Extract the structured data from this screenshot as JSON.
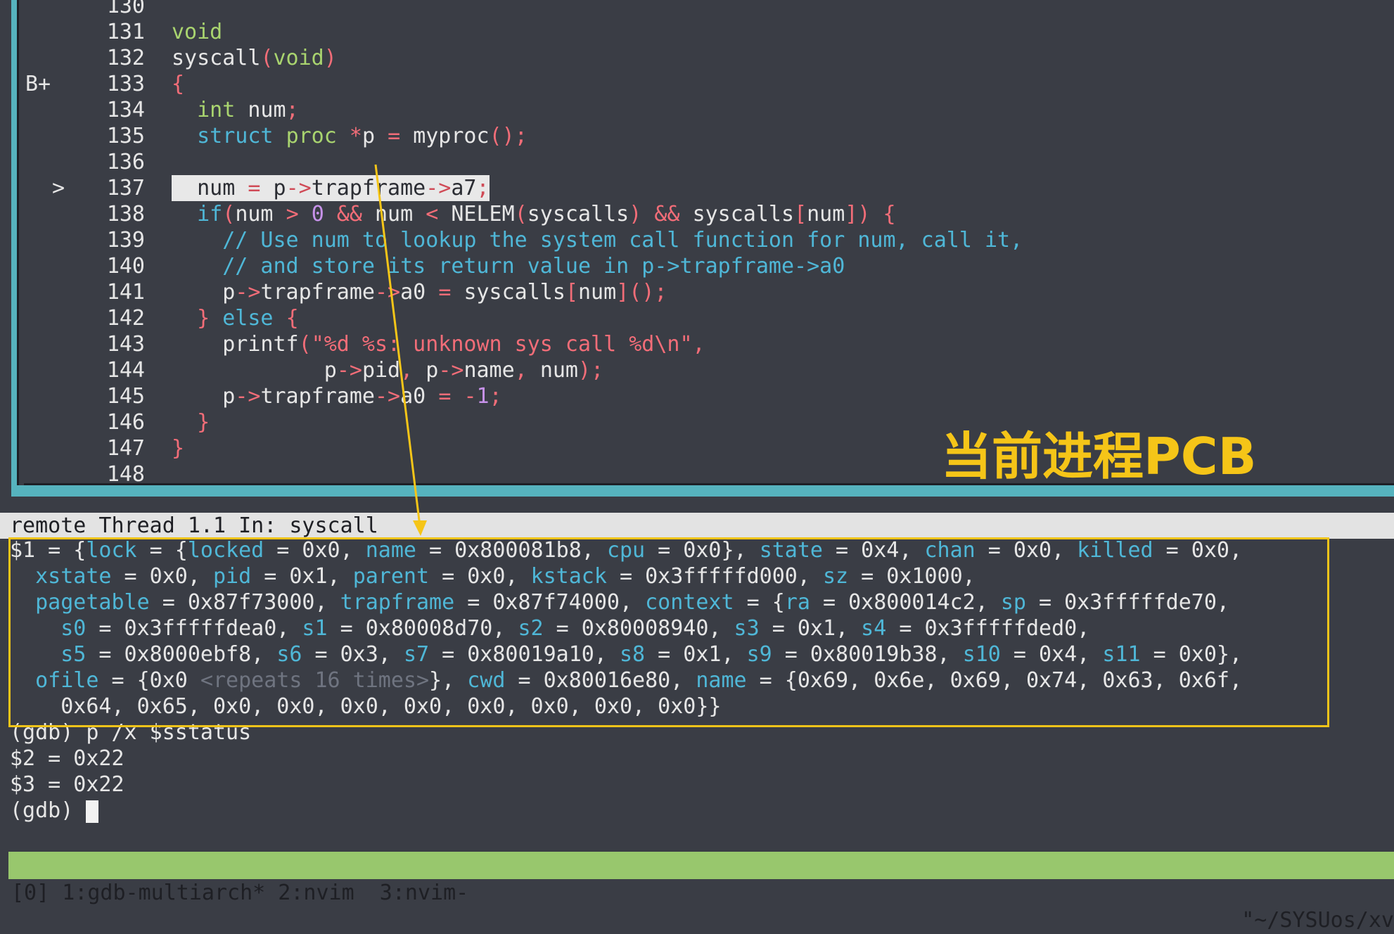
{
  "source": {
    "lines": [
      {
        "num": "130",
        "mark": "",
        "code": ""
      },
      {
        "num": "131",
        "mark": "",
        "code": "void"
      },
      {
        "num": "132",
        "mark": "",
        "code": "syscall(void)"
      },
      {
        "num": "133",
        "mark": "B+",
        "code": "{"
      },
      {
        "num": "134",
        "mark": "",
        "code": "  int num;"
      },
      {
        "num": "135",
        "mark": "",
        "code": "  struct proc *p = myproc();"
      },
      {
        "num": "136",
        "mark": "",
        "code": ""
      },
      {
        "num": "137",
        "mark": ">",
        "code": "  num = p->trapframe->a7;"
      },
      {
        "num": "138",
        "mark": "",
        "code": "  if(num > 0 && num < NELEM(syscalls) && syscalls[num]) {"
      },
      {
        "num": "139",
        "mark": "",
        "code": "    // Use num to lookup the system call function for num, call it,"
      },
      {
        "num": "140",
        "mark": "",
        "code": "    // and store its return value in p->trapframe->a0"
      },
      {
        "num": "141",
        "mark": "",
        "code": "    p->trapframe->a0 = syscalls[num]();"
      },
      {
        "num": "142",
        "mark": "",
        "code": "  } else {"
      },
      {
        "num": "143",
        "mark": "",
        "code": "    printf(\"%d %s: unknown sys call %d\\n\","
      },
      {
        "num": "144",
        "mark": "",
        "code": "            p->pid, p->name, num);"
      },
      {
        "num": "145",
        "mark": "",
        "code": "    p->trapframe->a0 = -1;"
      },
      {
        "num": "146",
        "mark": "",
        "code": "  }"
      },
      {
        "num": "147",
        "mark": "",
        "code": "}"
      },
      {
        "num": "148",
        "mark": "",
        "code": ""
      }
    ]
  },
  "status_line": "remote Thread 1.1 In: syscall",
  "gdb_output": [
    "$1 = {lock = {locked = 0x0, name = 0x800081b8, cpu = 0x0}, state = 0x4, chan = 0x0, killed = 0x0,",
    "  xstate = 0x0, pid = 0x1, parent = 0x0, kstack = 0x3fffffd000, sz = 0x1000,",
    "  pagetable = 0x87f73000, trapframe = 0x87f74000, context = {ra = 0x800014c2, sp = 0x3fffffde70,",
    "    s0 = 0x3fffffdea0, s1 = 0x80008d70, s2 = 0x80008940, s3 = 0x1, s4 = 0x3fffffded0,",
    "    s5 = 0x8000ebf8, s6 = 0x3, s7 = 0x80019a10, s8 = 0x1, s9 = 0x80019b38, s10 = 0x4, s11 = 0x0},",
    "  ofile = {0x0 <repeats 16 times>}, cwd = 0x80016e80, name = {0x69, 0x6e, 0x69, 0x74, 0x63, 0x6f,",
    "    0x64, 0x65, 0x0, 0x0, 0x0, 0x0, 0x0, 0x0, 0x0, 0x0}}",
    "(gdb) p /x $sstatus",
    "$2 = 0x22",
    "$3 = 0x22",
    "(gdb) "
  ],
  "tmux": {
    "left": "[0] 1:gdb-multiarch* 2:nvim  3:nvim-",
    "right": "\"~/SYSUos/xv"
  },
  "annotation": {
    "label": "当前进程PCB",
    "color": "#f5c518"
  },
  "colors": {
    "background": "#3a3d45",
    "border_accent": "#56b3be",
    "field_name": "#4fb7d7",
    "keyword": "#a9d46f",
    "punctuation": "#f26d78",
    "tmux_bar": "#98c76d",
    "highlight_box": "#f0c419"
  }
}
